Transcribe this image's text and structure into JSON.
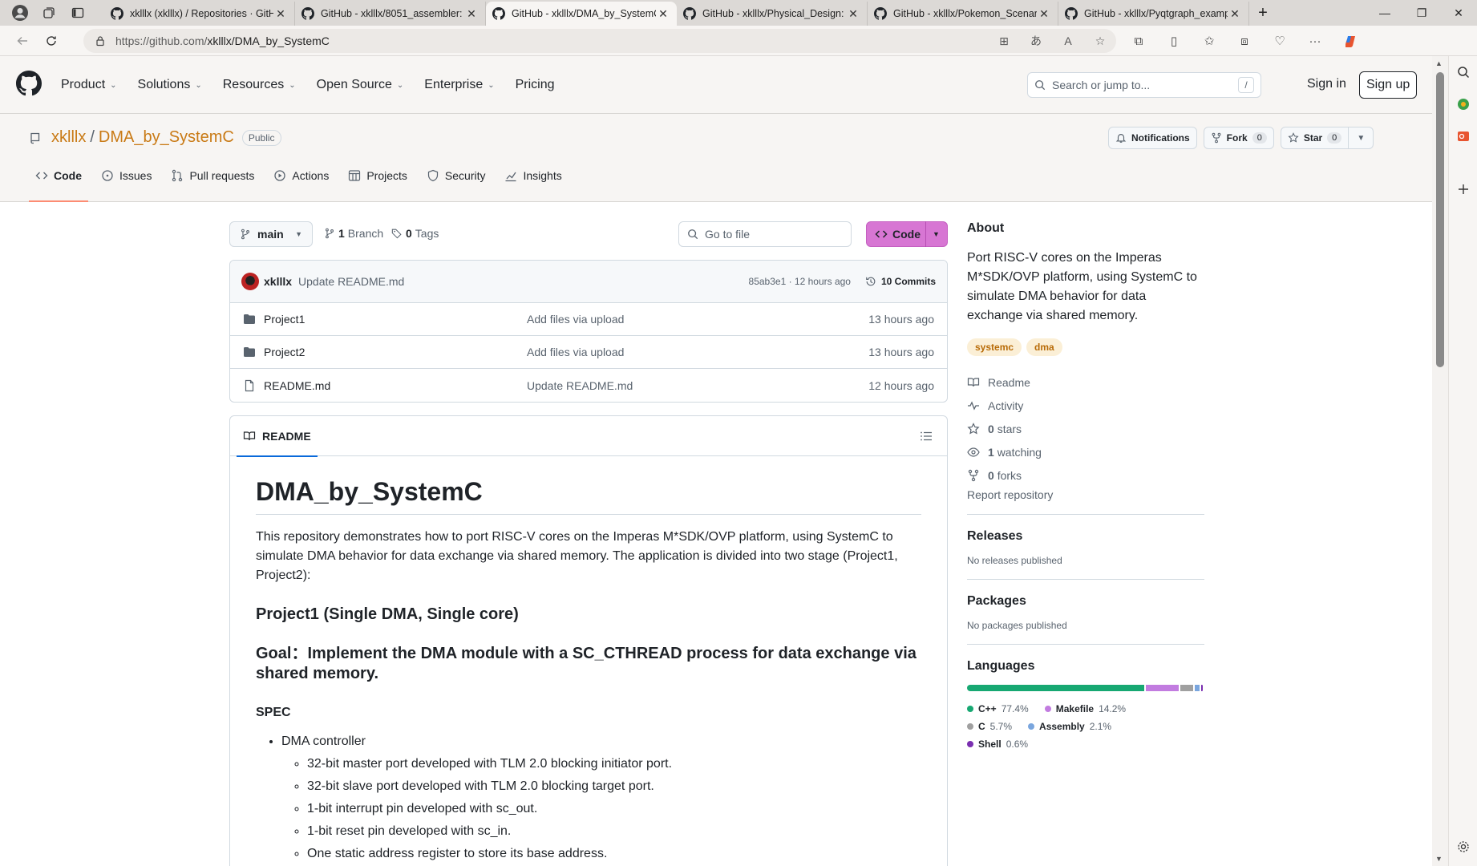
{
  "browser": {
    "tabs": [
      {
        "title": "xklllx (xklllx) / Repositories · GitHub",
        "active": false
      },
      {
        "title": "GitHub - xklllx/8051_assembler: ...",
        "active": false
      },
      {
        "title": "GitHub - xklllx/DMA_by_SystemC",
        "active": true
      },
      {
        "title": "GitHub - xklllx/Physical_Design: ...",
        "active": false
      },
      {
        "title": "GitHub - xklllx/Pokemon_Scenario",
        "active": false
      },
      {
        "title": "GitHub - xklllx/Pyqtgraph_example",
        "active": false
      }
    ],
    "url_prefix": "https://github.com/",
    "url_path": "xklllx/DMA_by_SystemC"
  },
  "gh_header": {
    "nav": [
      "Product",
      "Solutions",
      "Resources",
      "Open Source",
      "Enterprise"
    ],
    "pricing": "Pricing",
    "search_placeholder": "Search or jump to...",
    "search_key": "/",
    "sign_in": "Sign in",
    "sign_up": "Sign up"
  },
  "repo": {
    "owner": "xklllx",
    "name": "DMA_by_SystemC",
    "visibility": "Public",
    "notifications": "Notifications",
    "fork_label": "Fork",
    "fork_count": "0",
    "star_label": "Star",
    "star_count": "0",
    "tabs": [
      "Code",
      "Issues",
      "Pull requests",
      "Actions",
      "Projects",
      "Security",
      "Insights"
    ]
  },
  "toolbar": {
    "branch": "main",
    "branch_count": "1",
    "branch_word": "Branch",
    "tag_count": "0",
    "tag_word": "Tags",
    "goto_placeholder": "Go to file",
    "code_button": "Code"
  },
  "commit": {
    "author": "xklllx",
    "message": "Update README.md",
    "sha_time": "85ab3e1 · 12 hours ago",
    "commits": "10 Commits"
  },
  "files": [
    {
      "name": "Project1",
      "type": "dir",
      "message": "Add files via upload",
      "age": "13 hours ago"
    },
    {
      "name": "Project2",
      "type": "dir",
      "message": "Add files via upload",
      "age": "13 hours ago"
    },
    {
      "name": "README.md",
      "type": "file",
      "message": "Update README.md",
      "age": "12 hours ago"
    }
  ],
  "readme": {
    "tab": "README",
    "h1": "DMA_by_SystemC",
    "intro": "This repository demonstrates how to port RISC-V cores on the Imperas M*SDK/OVP platform, using SystemC to simulate DMA behavior for data exchange via shared memory. The application is divided into two stage (Project1, Project2):",
    "h3_project": "Project1 (Single DMA, Single core)",
    "h3_goal": "Goal：Implement the DMA module with a SC_CTHREAD process for data exchange via shared memory.",
    "spec": "SPEC",
    "bullet": "DMA controller",
    "sub_bullets": [
      "32-bit master port developed with TLM 2.0 blocking initiator port.",
      "32-bit slave port developed with TLM 2.0 blocking target port.",
      "1-bit interrupt pin developed with sc_out.",
      "1-bit reset pin developed with sc_in.",
      "One static address register to store its base address."
    ]
  },
  "about": {
    "title": "About",
    "description": "Port RISC-V cores on the Imperas M*SDK/OVP platform, using SystemC to simulate DMA behavior for data exchange via shared memory.",
    "topics": [
      "systemc",
      "dma"
    ],
    "links": [
      {
        "icon": "book-icon",
        "label": "Readme",
        "count": ""
      },
      {
        "icon": "pulse-icon",
        "label": "Activity",
        "count": ""
      },
      {
        "icon": "star-icon",
        "label": "stars",
        "count": "0"
      },
      {
        "icon": "eye-icon",
        "label": "watching",
        "count": "1"
      },
      {
        "icon": "fork-icon",
        "label": "forks",
        "count": "0"
      }
    ],
    "report": "Report repository"
  },
  "releases": {
    "title": "Releases",
    "empty": "No releases published"
  },
  "packages": {
    "title": "Packages",
    "empty": "No packages published"
  },
  "languages": {
    "title": "Languages",
    "items": [
      {
        "name": "C++",
        "percent": "77.4%",
        "value": 77.4,
        "color": "#17a872"
      },
      {
        "name": "Makefile",
        "percent": "14.2%",
        "value": 14.2,
        "color": "#c27ce0"
      },
      {
        "name": "C",
        "percent": "5.7%",
        "value": 5.7,
        "color": "#a0a0a0"
      },
      {
        "name": "Assembly",
        "percent": "2.1%",
        "value": 2.1,
        "color": "#7aa6de"
      },
      {
        "name": "Shell",
        "percent": "0.6%",
        "value": 0.6,
        "color": "#7a2fb0"
      }
    ]
  }
}
